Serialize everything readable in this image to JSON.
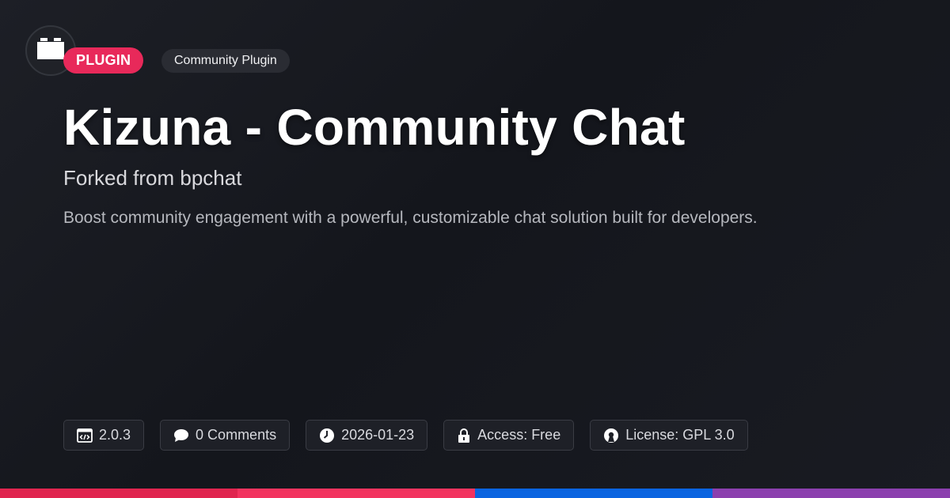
{
  "badges": {
    "type": "PLUGIN",
    "category": "Community Plugin"
  },
  "title": "Kizuna - Community Chat",
  "subtitle": "Forked from bpchat",
  "description": "Boost community engagement with a powerful, customizable chat solution built for developers.",
  "meta": [
    {
      "icon": "code-window-icon",
      "label": "2.0.3"
    },
    {
      "icon": "comment-icon",
      "label": "0 Comments"
    },
    {
      "icon": "clock-icon",
      "label": "2026-01-23"
    },
    {
      "icon": "lock-icon",
      "label": "Access: Free"
    },
    {
      "icon": "open-source-icon",
      "label": "License: GPL 3.0"
    }
  ],
  "colors": {
    "accent": "#e8295a",
    "stripe": [
      "#e0254f",
      "#f2335f",
      "#0a64e0",
      "#8b3fae"
    ]
  }
}
